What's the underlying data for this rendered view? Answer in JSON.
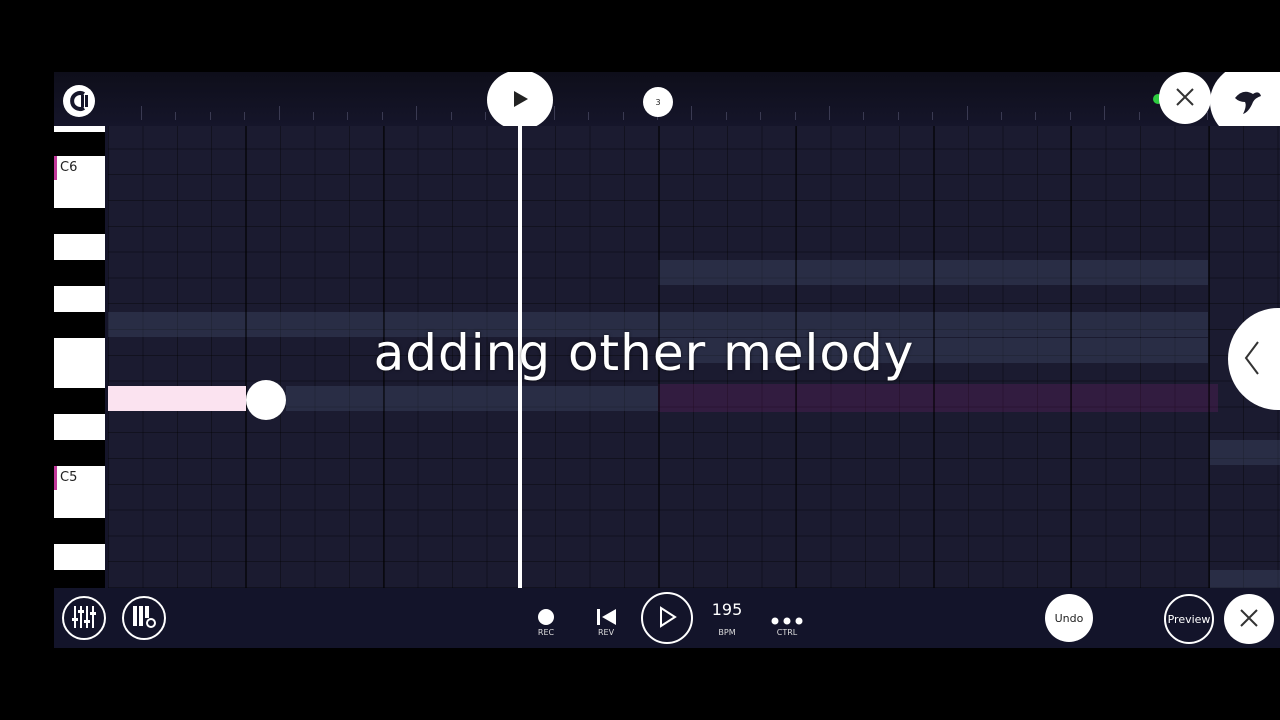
{
  "timeline": {
    "bar_marker": "3"
  },
  "keyboard": {
    "labels": [
      "C6",
      "C5"
    ]
  },
  "overlay": {
    "caption": "adding other melody"
  },
  "transport": {
    "rec_label": "REC",
    "rev_label": "REV",
    "bpm_value": "195",
    "bpm_label": "BPM",
    "ctrl_label": "CTRL",
    "undo_label": "Undo",
    "preview_label": "Preview"
  },
  "colors": {
    "accent_note": "#fbe3f0",
    "key_marker": "#c2389a",
    "status_dot": "#2ecc40",
    "background": "#15152a"
  },
  "icons": [
    "logo-icon",
    "play-icon",
    "close-icon",
    "bird-icon",
    "chevron-left-icon",
    "mixer-icon",
    "piano-settings-icon",
    "record-icon",
    "rewind-icon",
    "more-icon"
  ]
}
